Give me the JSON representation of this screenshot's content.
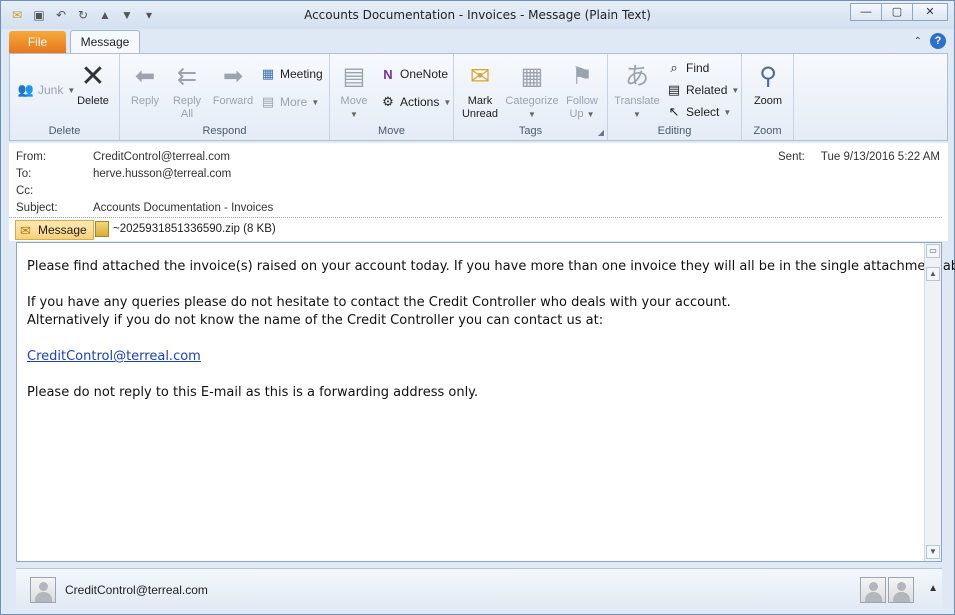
{
  "window": {
    "title": "Accounts Documentation - Invoices  -  Message (Plain Text)",
    "minimize": "—",
    "maximize": "▢",
    "close": "✕"
  },
  "tabs": {
    "file": "File",
    "message": "Message",
    "help": "?"
  },
  "ribbon": {
    "delete_group": {
      "junk": "Junk",
      "delete": "Delete",
      "label": "Delete"
    },
    "respond_group": {
      "reply": "Reply",
      "reply_all_1": "Reply",
      "reply_all_2": "All",
      "forward": "Forward",
      "meeting": "Meeting",
      "more": "More",
      "label": "Respond"
    },
    "move_group": {
      "move": "Move",
      "onenote": "OneNote",
      "actions": "Actions",
      "label": "Move"
    },
    "tags_group": {
      "mark_unread_1": "Mark",
      "mark_unread_2": "Unread",
      "categorize": "Categorize",
      "follow_up_1": "Follow",
      "follow_up_2": "Up",
      "label": "Tags"
    },
    "editing_group": {
      "translate": "Translate",
      "find": "Find",
      "related": "Related",
      "select": "Select",
      "label": "Editing"
    },
    "zoom_group": {
      "zoom": "Zoom",
      "label": "Zoom"
    }
  },
  "header": {
    "from_label": "From:",
    "from": "CreditControl@terreal.com",
    "to_label": "To:",
    "to": "herve.husson@terreal.com",
    "cc_label": "Cc:",
    "cc": "",
    "subject_label": "Subject:",
    "subject": "Accounts Documentation - Invoices",
    "sent_label": "Sent:",
    "sent": "Tue 9/13/2016 5:22 AM"
  },
  "attachments": {
    "message_tab": "Message",
    "file": "~2025931851336590.zip (8 KB)"
  },
  "body": {
    "line1": "Please find attached the invoice(s) raised on your account today. If you have more than one invoice they will all be in the single attachment above.",
    "line2": "If you have any queries please do not hesitate to contact the Credit Controller who deals with your account.",
    "line3": "Alternatively if you do not know the name of the Credit Controller you can contact us at:",
    "link": "CreditControl@terreal.com",
    "line4": "Please do not reply to this E-mail as this is a forwarding address only."
  },
  "people_pane": {
    "name": "CreditControl@terreal.com"
  },
  "colors": {
    "file_tab": "#e8771a",
    "link": "#1a3fbd",
    "window_bg": "#dfe9f5"
  }
}
